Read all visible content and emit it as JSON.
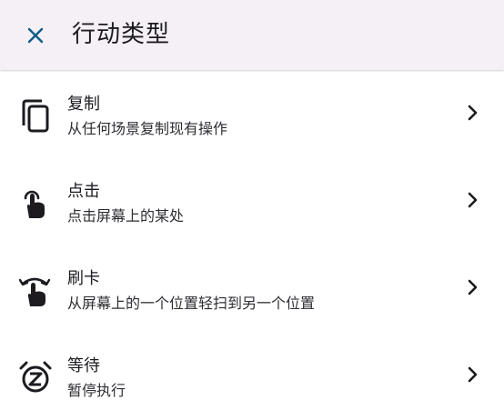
{
  "header": {
    "title": "行动类型",
    "close_icon": "close-icon"
  },
  "colors": {
    "app_bar_bg": "#f5eff6",
    "accent": "#0b5c86",
    "text": "#1d1b20"
  },
  "items": [
    {
      "icon": "copy-icon",
      "title": "复制",
      "description": "从任何场景复制现有操作"
    },
    {
      "icon": "tap-icon",
      "title": "点击",
      "description": "点击屏幕上的某处"
    },
    {
      "icon": "swipe-icon",
      "title": "刷卡",
      "description": "从屏幕上的一个位置轻扫到另一个位置"
    },
    {
      "icon": "snooze-alarm-icon",
      "title": "等待",
      "description": "暂停执行"
    }
  ]
}
